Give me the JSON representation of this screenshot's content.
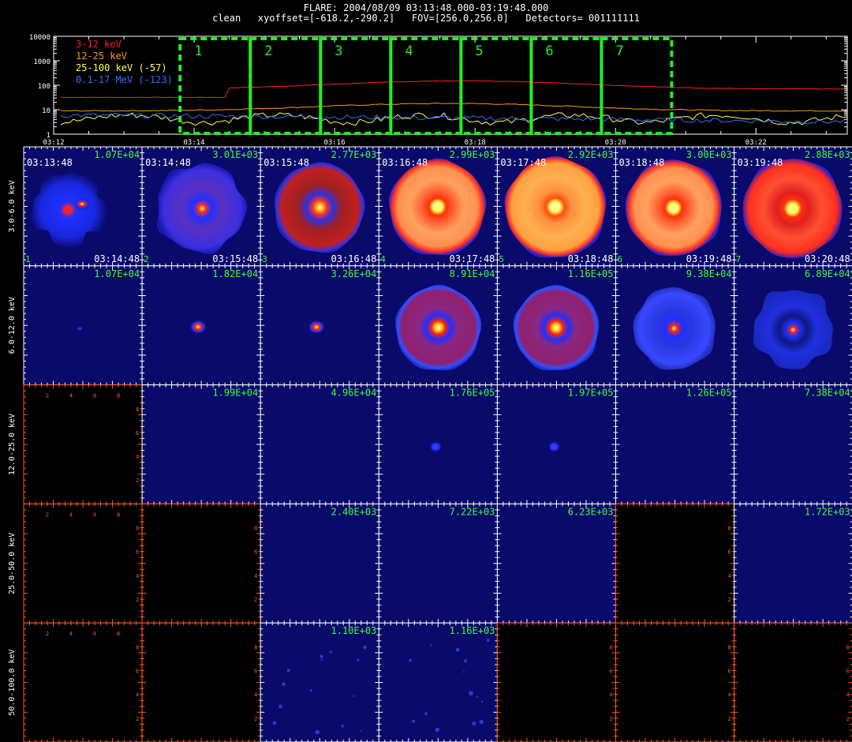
{
  "header": {
    "line1": "FLARE: 2004/08/09 03:13:48.000-03:19:48.000",
    "line2": "clean   xyoffset=[-618.2,-290.2]   FOV=[256.0,256.0]   Detectors= 001111111"
  },
  "lightcurve": {
    "y_ticks": [
      {
        "label": "10000",
        "value": 10000
      },
      {
        "label": "1000",
        "value": 1000
      },
      {
        "label": "100",
        "value": 100
      },
      {
        "label": "10",
        "value": 10
      },
      {
        "label": "1",
        "value": 1
      }
    ],
    "x_ticks": [
      "03:12",
      "03:14",
      "03:16",
      "03:18",
      "03:20",
      "03:22"
    ],
    "x_range_min": [
      12.0,
      23.3
    ],
    "y_range": [
      1,
      10000
    ],
    "y_scale": "log",
    "legend": [
      {
        "label": "3-12 keV",
        "color": "#ff2020"
      },
      {
        "label": "12-25 keV",
        "color": "#ff9900"
      },
      {
        "label": "25-100 keV (-57)",
        "color": "#ffff40"
      },
      {
        "label": "0.1-17 MeV (-123)",
        "color": "#3070ff"
      }
    ],
    "intervals": [
      {
        "label": "1",
        "start": 13.8,
        "end": 14.8
      },
      {
        "label": "2",
        "start": 14.8,
        "end": 15.8
      },
      {
        "label": "3",
        "start": 15.8,
        "end": 16.8
      },
      {
        "label": "4",
        "start": 16.8,
        "end": 17.8
      },
      {
        "label": "5",
        "start": 17.8,
        "end": 18.8
      },
      {
        "label": "6",
        "start": 18.8,
        "end": 19.8
      },
      {
        "label": "7",
        "start": 19.8,
        "end": 20.8
      }
    ],
    "interval_color": "#22ee22"
  },
  "grid": {
    "rows": [
      {
        "label": "3.0-6.0 keV"
      },
      {
        "label": "6.0-12.0 keV"
      },
      {
        "label": "12.0-25.0 keV"
      },
      {
        "label": "25.0-50.0 keV"
      },
      {
        "label": "50.0-100.0 keV"
      }
    ],
    "start_times": [
      "03:13:48",
      "03:14:48",
      "03:15:48",
      "03:16:48",
      "03:17:48",
      "03:18:48",
      "03:19:48"
    ],
    "end_times": [
      "03:14:48",
      "03:15:48",
      "03:16:48",
      "03:17:48",
      "03:18:48",
      "03:19:48",
      "03:20:48"
    ],
    "interval_numbers": [
      "1",
      "2",
      "3",
      "4",
      "5",
      "6",
      "7"
    ],
    "maxima": [
      [
        "1.07E+04",
        "3.01E+03",
        "2.77E+03",
        "2.99E+03",
        "2.92E+03",
        "3.00E+03",
        "2.88E+03"
      ],
      [
        "1.07E+04",
        "1.82E+04",
        "3.26E+04",
        "8.91E+04",
        "1.16E+05",
        "9.38E+04",
        "6.89E+04"
      ],
      [
        "",
        "1.99E+04",
        "4.96E+04",
        "1.76E+05",
        "1.97E+05",
        "1.26E+05",
        "7.38E+04"
      ],
      [
        "",
        "",
        "2.40E+03",
        "7.22E+03",
        "6.23E+03",
        "",
        "1.72E+03"
      ],
      [
        "",
        "",
        "1.10E+03",
        "1.16E+03",
        "",
        "",
        ""
      ]
    ],
    "empty_axis_ticks": [
      "2",
      "4",
      "6",
      "8"
    ]
  }
}
